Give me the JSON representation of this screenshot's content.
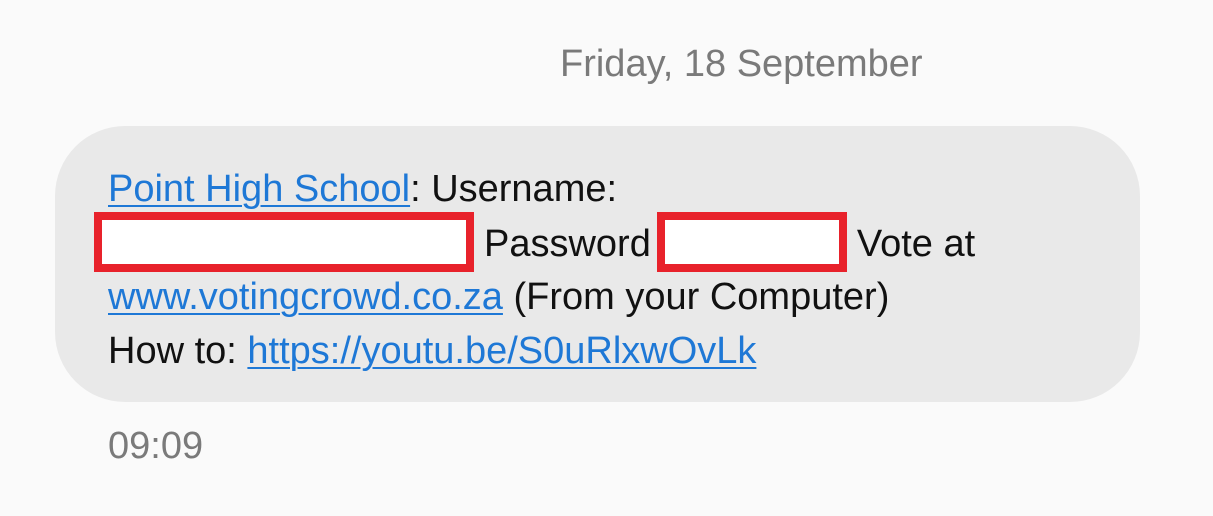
{
  "conversation": {
    "date_header": "Friday, 18 September"
  },
  "message": {
    "sender_link": "Point High School",
    "username_label": ": Username:",
    "password_label": "Password",
    "vote_at": "Vote at",
    "vote_link": "www.votingcrowd.co.za",
    "from_computer": "(From your Computer)",
    "how_to_label": "How to:",
    "how_to_link": "https://youtu.be/S0uRlxwOvLk",
    "time": "09:09"
  },
  "colors": {
    "link": "#1e78d6",
    "bubble": "#e9e9e9",
    "redaction_border": "#e8222b"
  }
}
